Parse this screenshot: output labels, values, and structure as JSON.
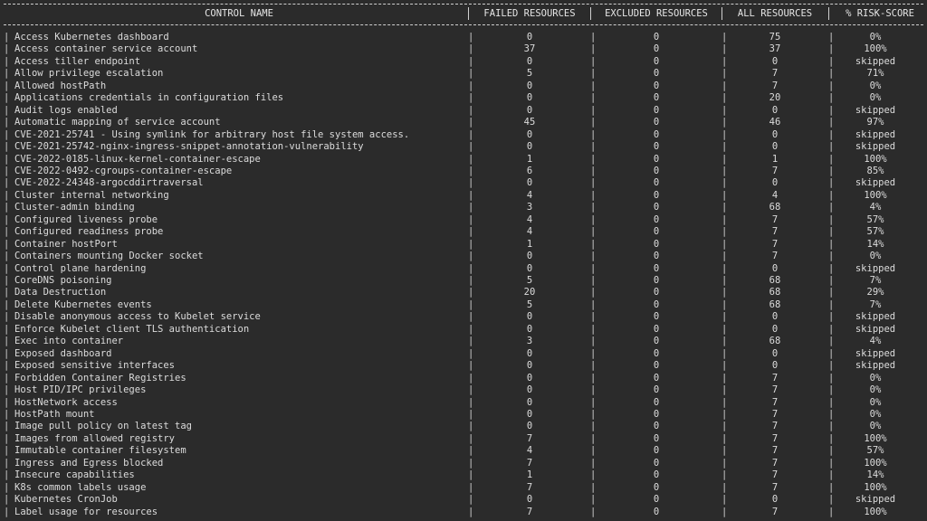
{
  "headers": {
    "control_name": "CONTROL NAME",
    "failed": "FAILED RESOURCES",
    "excluded": "EXCLUDED RESOURCES",
    "all": "ALL RESOURCES",
    "risk": "% RISK-SCORE"
  },
  "rows": [
    {
      "name": "Access Kubernetes dashboard",
      "failed": "0",
      "excluded": "0",
      "all": "75",
      "risk": "0%"
    },
    {
      "name": "Access container service account",
      "failed": "37",
      "excluded": "0",
      "all": "37",
      "risk": "100%"
    },
    {
      "name": "Access tiller endpoint",
      "failed": "0",
      "excluded": "0",
      "all": "0",
      "risk": "skipped"
    },
    {
      "name": "Allow privilege escalation",
      "failed": "5",
      "excluded": "0",
      "all": "7",
      "risk": "71%"
    },
    {
      "name": "Allowed hostPath",
      "failed": "0",
      "excluded": "0",
      "all": "7",
      "risk": "0%"
    },
    {
      "name": "Applications credentials in configuration files",
      "failed": "0",
      "excluded": "0",
      "all": "20",
      "risk": "0%"
    },
    {
      "name": "Audit logs enabled",
      "failed": "0",
      "excluded": "0",
      "all": "0",
      "risk": "skipped"
    },
    {
      "name": "Automatic mapping of service account",
      "failed": "45",
      "excluded": "0",
      "all": "46",
      "risk": "97%"
    },
    {
      "name": "CVE-2021-25741 - Using symlink for arbitrary host file system access.",
      "failed": "0",
      "excluded": "0",
      "all": "0",
      "risk": "skipped"
    },
    {
      "name": "CVE-2021-25742-nginx-ingress-snippet-annotation-vulnerability",
      "failed": "0",
      "excluded": "0",
      "all": "0",
      "risk": "skipped"
    },
    {
      "name": "CVE-2022-0185-linux-kernel-container-escape",
      "failed": "1",
      "excluded": "0",
      "all": "1",
      "risk": "100%"
    },
    {
      "name": "CVE-2022-0492-cgroups-container-escape",
      "failed": "6",
      "excluded": "0",
      "all": "7",
      "risk": "85%"
    },
    {
      "name": "CVE-2022-24348-argocddirtraversal",
      "failed": "0",
      "excluded": "0",
      "all": "0",
      "risk": "skipped"
    },
    {
      "name": "Cluster internal networking",
      "failed": "4",
      "excluded": "0",
      "all": "4",
      "risk": "100%"
    },
    {
      "name": "Cluster-admin binding",
      "failed": "3",
      "excluded": "0",
      "all": "68",
      "risk": "4%"
    },
    {
      "name": "Configured liveness probe",
      "failed": "4",
      "excluded": "0",
      "all": "7",
      "risk": "57%"
    },
    {
      "name": "Configured readiness probe",
      "failed": "4",
      "excluded": "0",
      "all": "7",
      "risk": "57%"
    },
    {
      "name": "Container hostPort",
      "failed": "1",
      "excluded": "0",
      "all": "7",
      "risk": "14%"
    },
    {
      "name": "Containers mounting Docker socket",
      "failed": "0",
      "excluded": "0",
      "all": "7",
      "risk": "0%"
    },
    {
      "name": "Control plane hardening",
      "failed": "0",
      "excluded": "0",
      "all": "0",
      "risk": "skipped"
    },
    {
      "name": "CoreDNS poisoning",
      "failed": "5",
      "excluded": "0",
      "all": "68",
      "risk": "7%"
    },
    {
      "name": "Data Destruction",
      "failed": "20",
      "excluded": "0",
      "all": "68",
      "risk": "29%"
    },
    {
      "name": "Delete Kubernetes events",
      "failed": "5",
      "excluded": "0",
      "all": "68",
      "risk": "7%"
    },
    {
      "name": "Disable anonymous access to Kubelet service",
      "failed": "0",
      "excluded": "0",
      "all": "0",
      "risk": "skipped"
    },
    {
      "name": "Enforce Kubelet client TLS authentication",
      "failed": "0",
      "excluded": "0",
      "all": "0",
      "risk": "skipped"
    },
    {
      "name": "Exec into container",
      "failed": "3",
      "excluded": "0",
      "all": "68",
      "risk": "4%"
    },
    {
      "name": "Exposed dashboard",
      "failed": "0",
      "excluded": "0",
      "all": "0",
      "risk": "skipped"
    },
    {
      "name": "Exposed sensitive interfaces",
      "failed": "0",
      "excluded": "0",
      "all": "0",
      "risk": "skipped"
    },
    {
      "name": "Forbidden Container Registries",
      "failed": "0",
      "excluded": "0",
      "all": "7",
      "risk": "0%"
    },
    {
      "name": "Host PID/IPC privileges",
      "failed": "0",
      "excluded": "0",
      "all": "7",
      "risk": "0%"
    },
    {
      "name": "HostNetwork access",
      "failed": "0",
      "excluded": "0",
      "all": "7",
      "risk": "0%"
    },
    {
      "name": "HostPath mount",
      "failed": "0",
      "excluded": "0",
      "all": "7",
      "risk": "0%"
    },
    {
      "name": "Image pull policy on latest tag",
      "failed": "0",
      "excluded": "0",
      "all": "7",
      "risk": "0%"
    },
    {
      "name": "Images from allowed registry",
      "failed": "7",
      "excluded": "0",
      "all": "7",
      "risk": "100%"
    },
    {
      "name": "Immutable container filesystem",
      "failed": "4",
      "excluded": "0",
      "all": "7",
      "risk": "57%"
    },
    {
      "name": "Ingress and Egress blocked",
      "failed": "7",
      "excluded": "0",
      "all": "7",
      "risk": "100%"
    },
    {
      "name": "Insecure capabilities",
      "failed": "1",
      "excluded": "0",
      "all": "7",
      "risk": "14%"
    },
    {
      "name": "K8s common labels usage",
      "failed": "7",
      "excluded": "0",
      "all": "7",
      "risk": "100%"
    },
    {
      "name": "Kubernetes CronJob",
      "failed": "0",
      "excluded": "0",
      "all": "0",
      "risk": "skipped"
    },
    {
      "name": "Label usage for resources",
      "failed": "7",
      "excluded": "0",
      "all": "7",
      "risk": "100%"
    }
  ]
}
